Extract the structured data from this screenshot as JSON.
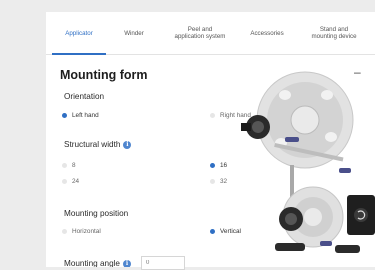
{
  "tabs": [
    {
      "label": "Applicator",
      "active": true
    },
    {
      "label": "Winder",
      "active": false
    },
    {
      "label": "Peel and\napplication system",
      "active": false
    },
    {
      "label": "Accessories",
      "active": false
    },
    {
      "label": "Stand and\nmounting device",
      "active": false
    }
  ],
  "section": {
    "title": "Mounting form",
    "collapse_symbol": "–"
  },
  "orientation": {
    "label": "Orientation",
    "options": [
      "Left hand",
      "Right hand"
    ],
    "selected": "Left hand"
  },
  "structural_width": {
    "label": "Structural width",
    "options": [
      "8",
      "16",
      "24",
      "32"
    ],
    "selected": "16"
  },
  "mounting_position": {
    "label": "Mounting position",
    "options": [
      "Horizontal",
      "Vertical"
    ],
    "selected": "Vertical"
  },
  "mounting_angle": {
    "label": "Mounting angle",
    "value": "0"
  },
  "colors": {
    "accent": "#2f6fc4",
    "machine_body": "#1f1f1f",
    "reel": "#dcdcdc"
  }
}
